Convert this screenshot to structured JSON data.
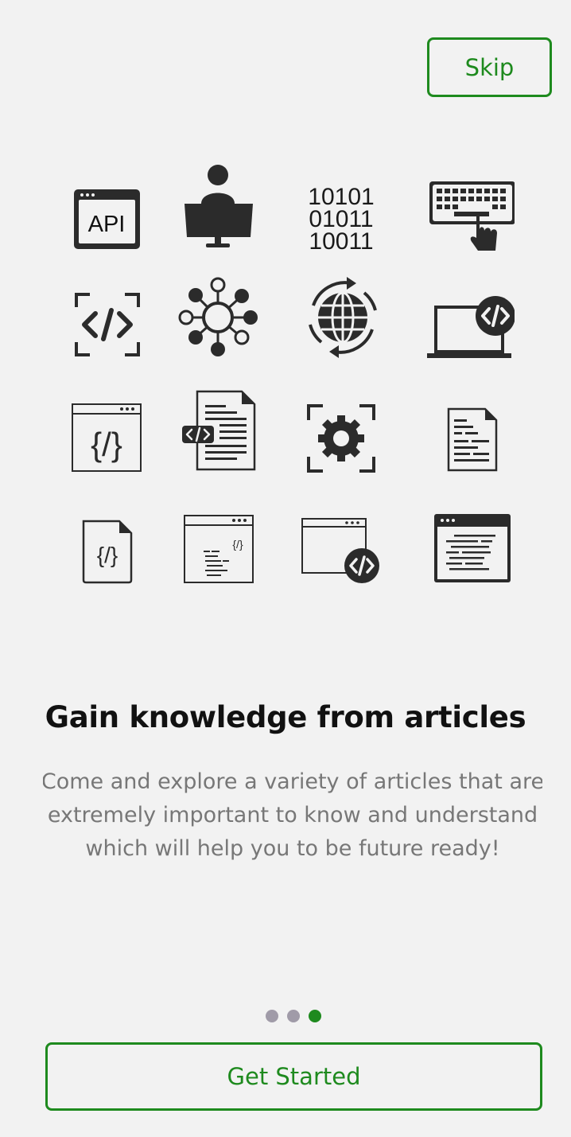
{
  "header": {
    "skip_label": "Skip"
  },
  "illustration": {
    "api_label": "API",
    "binary_lines": [
      "10101",
      "01011",
      "10011"
    ],
    "icons": [
      "api-window-icon",
      "developer-at-desk-icon",
      "binary-code-icon",
      "keyboard-typing-icon",
      "code-scan-icon",
      "network-hub-icon",
      "global-sync-icon",
      "laptop-code-icon",
      "browser-code-icon",
      "code-document-icon",
      "gear-scan-icon",
      "text-document-icon",
      "code-file-icon",
      "code-editor-window-icon",
      "browser-code-badge-icon",
      "dark-code-window-icon"
    ]
  },
  "content": {
    "title": "Gain knowledge from articles",
    "body_lines": [
      "Come and explore a variety of articles that are",
      "extremely important to know and understand",
      "which will help you to be future ready!"
    ]
  },
  "pager": {
    "total": 3,
    "active_index": 2
  },
  "footer": {
    "cta_label": "Get Started"
  },
  "colors": {
    "accent": "#1e8a1e",
    "background": "#f2f2f2",
    "icon_dark": "#2b2b2b",
    "dot_inactive": "#a09ba8"
  }
}
